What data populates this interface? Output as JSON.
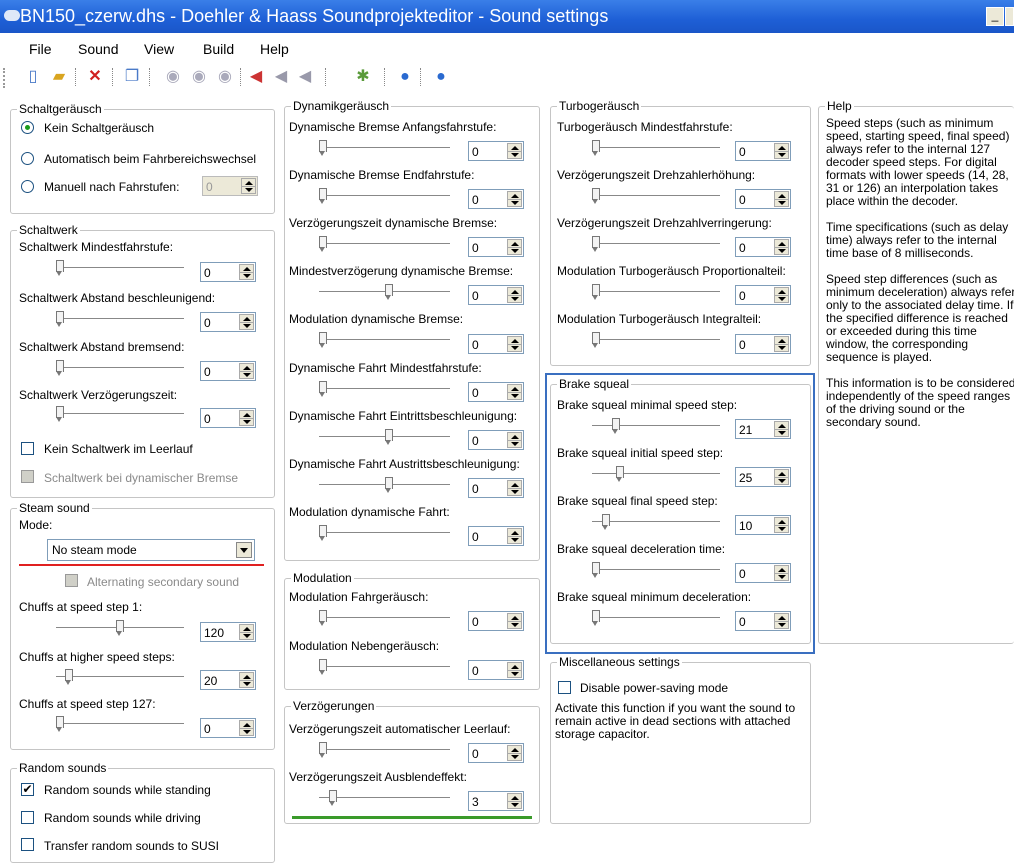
{
  "window": {
    "title": "BN150_czerw.dhs - Doehler & Haass Soundprojekteditor - Sound settings",
    "minimize": "_"
  },
  "menu": [
    "File",
    "Sound",
    "View",
    "Build",
    "Help"
  ],
  "toolbar": {
    "icons": [
      "new-file-icon",
      "open-folder-icon",
      "delete-icon",
      "copy-icon",
      "play-icon",
      "stop-icon",
      "record-icon",
      "volume-down-icon",
      "volume-mid-icon",
      "volume-up-icon",
      "build-icon",
      "help-icon",
      "info-icon"
    ]
  },
  "schaltgeraeusch": {
    "title": "Schaltgeräusch",
    "opt1": "Kein Schaltgeräusch",
    "opt2": "Automatisch beim Fahrbereichswechsel",
    "opt3": "Manuell nach Fahrstufen:",
    "manual_value": "0"
  },
  "schaltwerk": {
    "title": "Schaltwerk",
    "s1": "Schaltwerk Mindestfahrstufe:",
    "v1": "0",
    "s2": "Schaltwerk Abstand beschleunigend:",
    "v2": "0",
    "s3": "Schaltwerk Abstand bremsend:",
    "v3": "0",
    "s4": "Schaltwerk Verzögerungszeit:",
    "v4": "0",
    "c1": "Kein Schaltwerk im Leerlauf",
    "c2": "Schaltwerk bei dynamischer Bremse"
  },
  "steam": {
    "title": "Steam sound",
    "mode_label": "Mode:",
    "mode_value": "No steam mode",
    "alt": "Alternating secondary sound",
    "s1": "Chuffs at speed step 1:",
    "v1": "120",
    "s2": "Chuffs at higher speed steps:",
    "v2": "20",
    "s3": "Chuffs at speed step 127:",
    "v3": "0",
    "underline_color": "#e02020"
  },
  "random": {
    "title": "Random sounds",
    "c1": "Random sounds while standing",
    "c2": "Random sounds while driving",
    "c3": "Transfer random sounds to SUSI"
  },
  "dynamik": {
    "title": "Dynamikgeräusch",
    "s1": "Dynamische Bremse Anfangsfahrstufe:",
    "v1": "0",
    "s2": "Dynamische Bremse Endfahrstufe:",
    "v2": "0",
    "s3": "Verzögerungszeit dynamische Bremse:",
    "v3": "0",
    "s4": "Mindestverzögerung dynamische Bremse:",
    "v4": "0",
    "s5": "Modulation dynamische Bremse:",
    "v5": "0",
    "s6": "Dynamische Fahrt Mindestfahrstufe:",
    "v6": "0",
    "s7": "Dynamische Fahrt Eintrittsbeschleunigung:",
    "v7": "0",
    "s8": "Dynamische Fahrt Austrittsbeschleunigung:",
    "v8": "0",
    "s9": "Modulation dynamische Fahrt:",
    "v9": "0"
  },
  "modulation": {
    "title": "Modulation",
    "s1": "Modulation Fahrgeräusch:",
    "v1": "0",
    "s2": "Modulation Nebengeräusch:",
    "v2": "0"
  },
  "verz": {
    "title": "Verzögerungen",
    "s1": "Verzögerungszeit automatischer Leerlauf:",
    "v1": "0",
    "s2": "Verzögerungszeit Ausblendeffekt:",
    "v2": "3",
    "underline_color": "#3a9a2a"
  },
  "turbo": {
    "title": "Turbogeräusch",
    "s1": "Turbogeräusch Mindestfahrstufe:",
    "v1": "0",
    "s2": "Verzögerungszeit Drehzahlerhöhung:",
    "v2": "0",
    "s3": "Verzögerungszeit Drehzahlverringerung:",
    "v3": "0",
    "s4": "Modulation Turbogeräusch Proportionalteil:",
    "v4": "0",
    "s5": "Modulation Turbogeräusch Integralteil:",
    "v5": "0"
  },
  "brake": {
    "title": "Brake squeal",
    "s1": "Brake squeal minimal speed step:",
    "v1": "21",
    "s2": "Brake squeal initial speed step:",
    "v2": "25",
    "s3": "Brake squeal final speed step:",
    "v3": "10",
    "s4": "Brake squeal deceleration time:",
    "v4": "0",
    "s5": "Brake squeal minimum deceleration:",
    "v5": "0",
    "highlight_color": "#3a6fc0"
  },
  "misc": {
    "title": "Miscellaneous settings",
    "c1": "Disable power-saving mode",
    "desc": "Activate this function if you want the sound to remain active in dead sections with attached storage capacitor."
  },
  "help": {
    "title": "Help",
    "p1": "Speed steps (such as minimum speed, starting speed, final speed) always refer to the internal 127 decoder speed steps. For digital formats with lower speeds (14, 28, 31 or 126) an interpolation takes place within the decoder.",
    "p2": "Time specifications (such as delay time) always refer to the internal time base of 8 milliseconds.",
    "p3": "Speed step differences (such as minimum deceleration) always refer only to the associated delay time. If the specified difference is reached or exceeded during this time window, the corresponding sequence is played.",
    "p4": "This information is to be considered independently of the speed ranges of the driving sound or the secondary sound."
  }
}
